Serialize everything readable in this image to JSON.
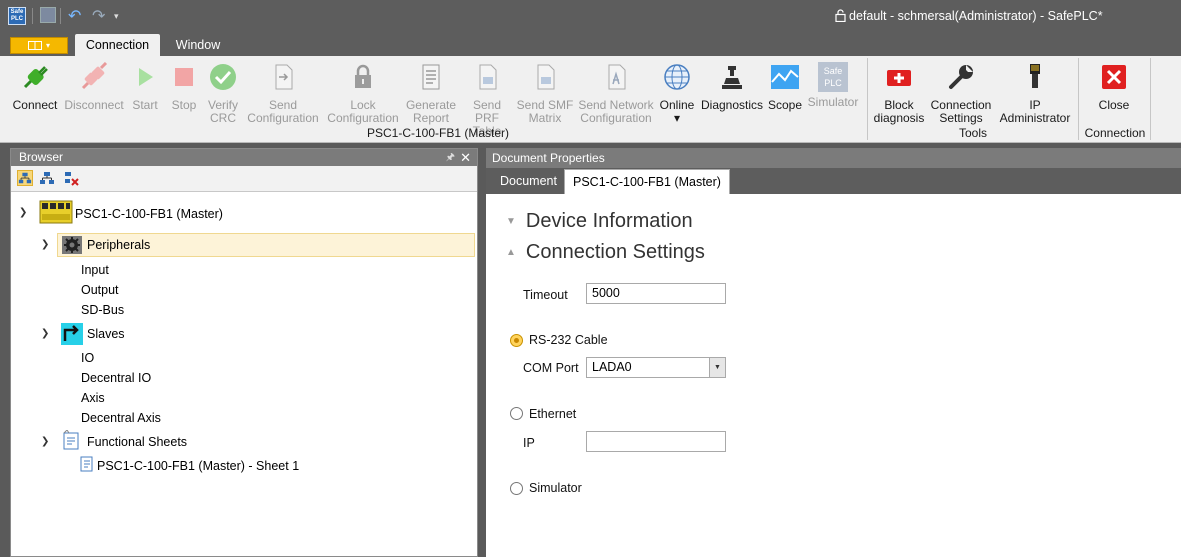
{
  "titlebar": {
    "app_logo": "Safe PLC",
    "title": "default - schmersal(Administrator) - SafePLC*"
  },
  "menubar": {
    "tabs": [
      "Connection",
      "Window"
    ]
  },
  "ribbon": {
    "buttons": [
      {
        "label": "Connect",
        "enabled": true,
        "icon": "connect-plug-icon"
      },
      {
        "label": "Disconnect",
        "enabled": false,
        "icon": "disconnect-plug-icon"
      },
      {
        "label": "Start",
        "enabled": false,
        "icon": "play-icon"
      },
      {
        "label": "Stop",
        "enabled": false,
        "icon": "stop-icon"
      },
      {
        "label": "Verify\nCRC",
        "enabled": false,
        "icon": "verify-check-icon"
      },
      {
        "label": "Send\nConfiguration",
        "enabled": false,
        "icon": "send-document-icon"
      },
      {
        "label": "Lock\nConfiguration",
        "enabled": false,
        "icon": "padlock-icon"
      },
      {
        "label": "Generate\nReport",
        "enabled": false,
        "icon": "report-icon"
      },
      {
        "label": "Send PRF\nTable",
        "enabled": false,
        "icon": "prf-table-icon"
      },
      {
        "label": "Send SMF\nMatrix",
        "enabled": false,
        "icon": "smf-matrix-icon"
      },
      {
        "label": "Send Network\nConfiguration",
        "enabled": false,
        "icon": "network-config-icon"
      },
      {
        "label": "Online\n▾",
        "enabled": true,
        "icon": "globe-icon"
      },
      {
        "label": "Diagnostics",
        "enabled": true,
        "icon": "diagnostics-icon"
      },
      {
        "label": "Scope",
        "enabled": true,
        "icon": "scope-icon"
      },
      {
        "label": "Simulator",
        "enabled": false,
        "icon": "simulator-icon"
      },
      {
        "label": "Block\ndiagnosis",
        "enabled": true,
        "icon": "block-diagnosis-icon"
      },
      {
        "label": "Connection\nSettings",
        "enabled": true,
        "icon": "wrench-icon"
      },
      {
        "label": "IP\nAdministrator",
        "enabled": true,
        "icon": "network-plug-icon"
      },
      {
        "label": "Close",
        "enabled": true,
        "icon": "close-red-icon"
      }
    ],
    "groups": [
      "PSC1-C-100-FB1 (Master)",
      "Tools",
      "Connection"
    ],
    "simulator_icon_text": "Safe PLC"
  },
  "browser": {
    "title": "Browser",
    "tree": {
      "root": "PSC1-C-100-FB1 (Master)",
      "peripherals": {
        "label": "Peripherals",
        "children": [
          "Input",
          "Output",
          "SD-Bus"
        ]
      },
      "slaves": {
        "label": "Slaves",
        "children": [
          "IO",
          "Decentral IO",
          "Axis",
          "Decentral Axis"
        ]
      },
      "functional_sheets": {
        "label": "Functional Sheets",
        "children": [
          "PSC1-C-100-FB1 (Master) - Sheet 1"
        ]
      }
    }
  },
  "document": {
    "title": "Document Properties",
    "tabs": [
      "Document",
      "PSC1-C-100-FB1 (Master)"
    ],
    "sections": [
      "Device Information",
      "Connection Settings"
    ],
    "timeout_label": "Timeout",
    "timeout_value": "5000",
    "rs232_label": "RS-232 Cable",
    "com_port_label": "COM Port",
    "com_port_value": "LADA0",
    "ethernet_label": "Ethernet",
    "ip_label": "IP",
    "ip_value": "",
    "simulator_label": "Simulator",
    "selected_connection": "RS-232 Cable"
  },
  "colors": {
    "chrome_dark": "#5d5d5d",
    "panel_header": "#7b7b7b",
    "ribbon_bg": "#f0f0f0",
    "app_menu_yellow": "#f5b800",
    "selection_bg": "#fdf3d8"
  }
}
